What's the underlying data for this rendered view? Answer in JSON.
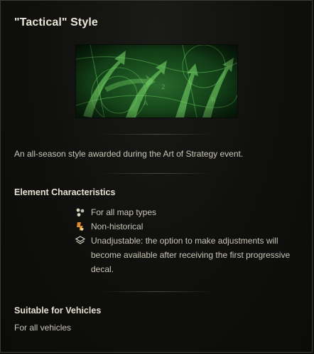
{
  "style": {
    "title": "\"Tactical\" Style",
    "description": "An all-season style awarded during the Art of Strategy event."
  },
  "characteristics": {
    "heading": "Element Characteristics",
    "items": [
      {
        "icon": "map-types-icon",
        "label": "For all map types"
      },
      {
        "icon": "non-historical-icon",
        "label": "Non-historical"
      },
      {
        "icon": "layers-icon",
        "label": "Unadjustable: the option to make adjustments will become available after receiving the first progressive decal."
      }
    ]
  },
  "vehicles": {
    "heading": "Suitable for Vehicles",
    "value": "For all vehicles"
  },
  "colors": {
    "background": "#0f0f0d",
    "text": "#c9c5b8",
    "heading": "#e6e1d2",
    "accent_green": "#2a6a2e",
    "accent_orange": "#e08a2a"
  }
}
